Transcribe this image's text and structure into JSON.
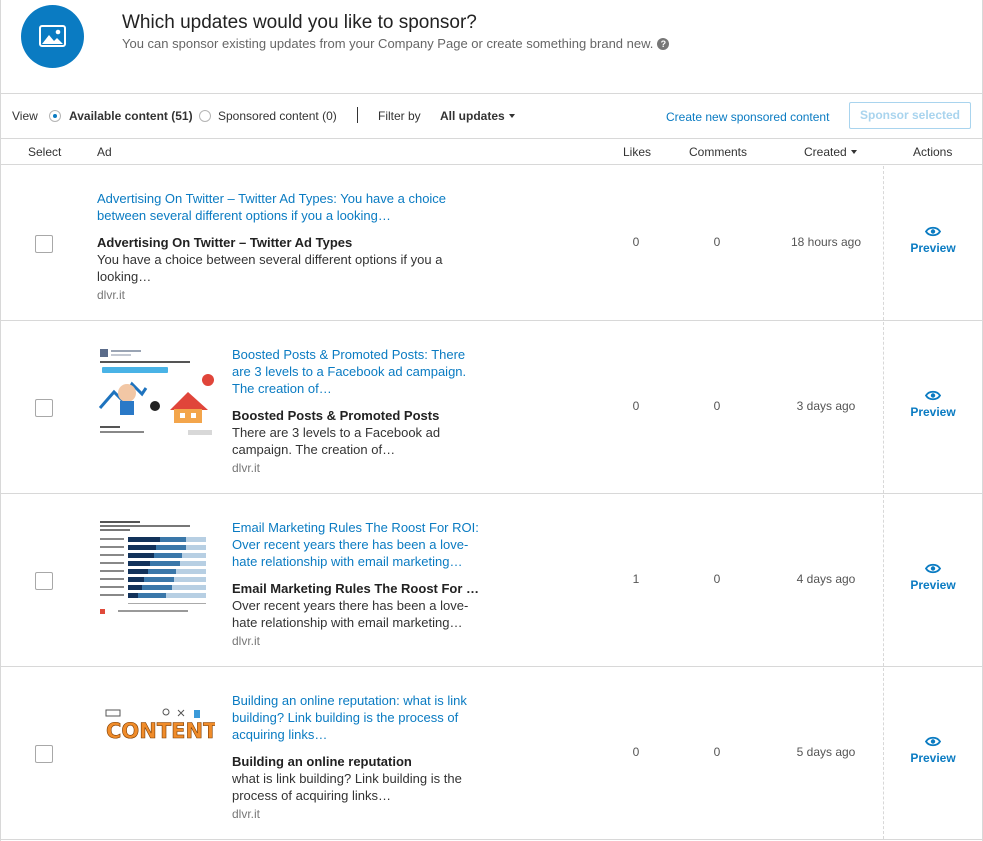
{
  "header": {
    "title": "Which updates would you like to sponsor?",
    "subtitle": "You can sponsor existing updates from your Company Page or create something brand new.",
    "badge_icon": "image-icon",
    "help_icon": "question-icon"
  },
  "toolbar": {
    "view_label": "View",
    "available_label": "Available content (51)",
    "sponsored_label": "Sponsored content (0)",
    "filter_label": "Filter by",
    "filter_value": "All updates",
    "create_link": "Create new sponsored content",
    "sponsor_button": "Sponsor selected"
  },
  "columns": {
    "select": "Select",
    "ad": "Ad",
    "likes": "Likes",
    "comments": "Comments",
    "created": "Created",
    "actions": "Actions"
  },
  "rows": [
    {
      "link_text": "Advertising On Twitter – Twitter Ad Types: You have a choice between several different options if you a looking…",
      "title": "Advertising On Twitter – Twitter Ad Types",
      "description": "You have a choice between several different options if you a looking…",
      "source": "dlvr.it",
      "likes": "0",
      "comments": "0",
      "created": "18 hours ago",
      "action": "Preview"
    },
    {
      "link_text": "Boosted Posts & Promoted Posts: There are 3 levels to a Facebook ad campaign. The creation of…",
      "title": "Boosted Posts & Promoted Posts",
      "description": "There are 3 levels to a Facebook ad campaign. The creation of…",
      "source": "dlvr.it",
      "likes": "0",
      "comments": "0",
      "created": "3 days ago",
      "action": "Preview"
    },
    {
      "link_text": "Email Marketing Rules The Roost For ROI: Over recent years there has been a love-hate relationship with email marketing…",
      "title": "Email Marketing Rules The Roost For …",
      "description": "Over recent years there has been a love-hate relationship with email marketing…",
      "source": "dlvr.it",
      "likes": "1",
      "comments": "0",
      "created": "4 days ago",
      "action": "Preview"
    },
    {
      "link_text": "Building an online reputation: what is link building? Link building is the process of acquiring links…",
      "title": "Building an online reputation",
      "description": "what is link building? Link building is the process of acquiring links…",
      "source": "dlvr.it",
      "likes": "0",
      "comments": "0",
      "created": "5 days ago",
      "action": "Preview",
      "thumb_text": "CONTENT"
    }
  ]
}
